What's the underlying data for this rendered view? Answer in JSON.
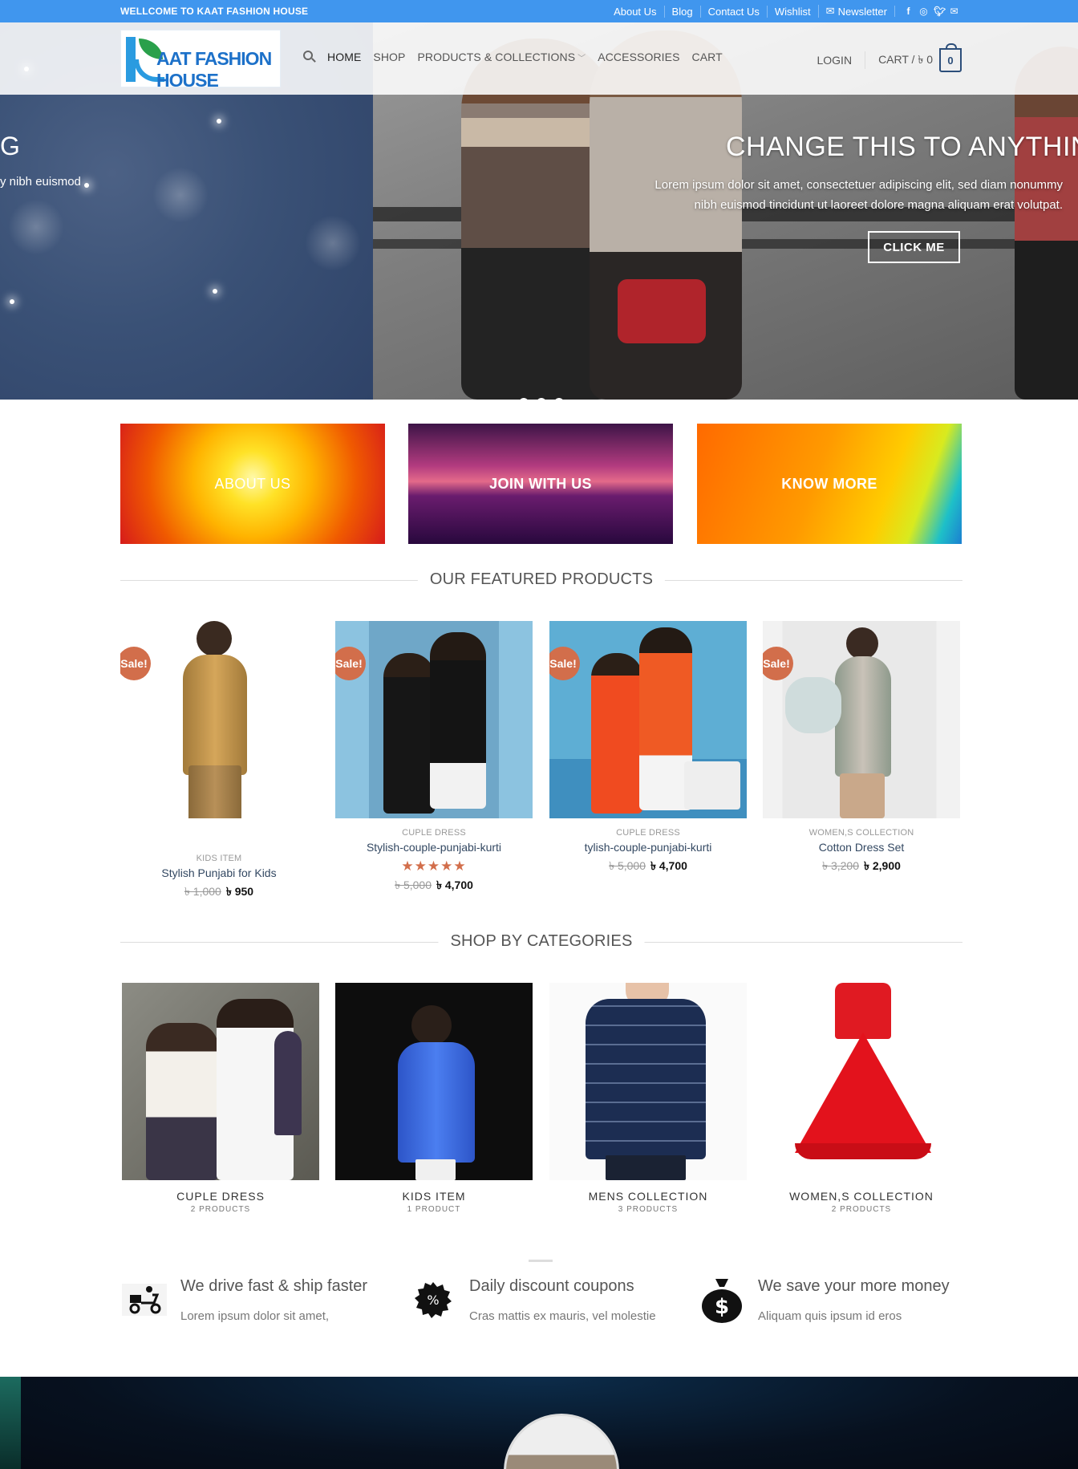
{
  "topbar": {
    "welcome": "WELLCOME TO KAAT FASHION HOUSE",
    "links": [
      "About Us",
      "Blog",
      "Contact Us",
      "Wishlist",
      "Newsletter"
    ],
    "social_icons": [
      "facebook-icon",
      "instagram-icon",
      "twitter-icon",
      "mail-icon"
    ]
  },
  "logo": {
    "text": "AAT FASHION HOUSE"
  },
  "nav": {
    "items": [
      "HOME",
      "SHOP",
      "PRODUCTS & COLLECTIONS",
      "ACCESSORIES",
      "CART"
    ],
    "login": "LOGIN",
    "cart_label": "CART / ৳ 0",
    "cart_count": "0"
  },
  "hero": {
    "left_title": "G",
    "left_text": "y nibh euismod",
    "title": "CHANGE THIS TO ANYTHING",
    "text": "Lorem ipsum dolor sit amet, consectetuer adipiscing elit, sed diam nonummy nibh euismod tincidunt ut laoreet dolore magna aliquam erat volutpat.",
    "button": "CLICK ME",
    "slides": 3,
    "active_slide": 1
  },
  "promos": [
    "ABOUT US",
    "JOIN WITH US",
    "KNOW MORE"
  ],
  "featured": {
    "title": "OUR FEATURED PRODUCTS",
    "products": [
      {
        "badge": "Sale!",
        "category": "KIDS ITEM",
        "name": "Stylish Punjabi for Kids",
        "old_price": "৳ 1,000",
        "price": "৳ 950",
        "rating": 0
      },
      {
        "badge": "Sale!",
        "category": "CUPLE DRESS",
        "name": "Stylish-couple-punjabi-kurti",
        "old_price": "৳ 5,000",
        "price": "৳ 4,700",
        "rating": 5
      },
      {
        "badge": "Sale!",
        "category": "CUPLE DRESS",
        "name": "tylish-couple-punjabi-kurti",
        "old_price": "৳ 5,000",
        "price": "৳ 4,700",
        "rating": 0
      },
      {
        "badge": "Sale!",
        "category": "WOMEN,S COLLECTION",
        "name": "Cotton Dress Set",
        "old_price": "৳ 3,200",
        "price": "৳ 2,900",
        "rating": 0
      }
    ]
  },
  "categories": {
    "title": "SHOP BY CATEGORIES",
    "items": [
      {
        "name": "CUPLE DRESS",
        "count": "2 PRODUCTS"
      },
      {
        "name": "KIDS ITEM",
        "count": "1 PRODUCT"
      },
      {
        "name": "MENS COLLECTION",
        "count": "3 PRODUCTS"
      },
      {
        "name": "WOMEN,S COLLECTION",
        "count": "2 PRODUCTS"
      }
    ]
  },
  "features": [
    {
      "icon": "delivery-scooter-icon",
      "title": "We drive fast & ship faster",
      "text": "Lorem ipsum dolor sit amet,"
    },
    {
      "icon": "discount-badge-icon",
      "title": "Daily discount coupons",
      "text": "Cras mattis ex mauris, vel molestie"
    },
    {
      "icon": "money-bag-icon",
      "title": "We save your more money",
      "text": "Aliquam quis ipsum id eros"
    }
  ],
  "colors": {
    "topbar": "#4096ee",
    "sale_badge": "#d26e4b",
    "link": "#334862",
    "cart": "#2c4e7a"
  }
}
